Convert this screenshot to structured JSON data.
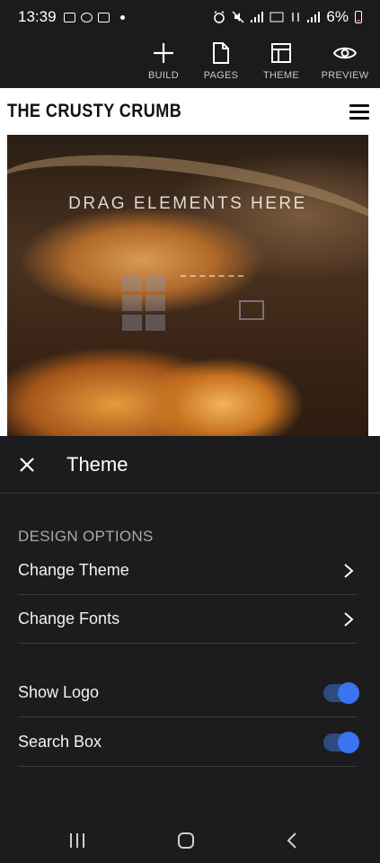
{
  "status_bar": {
    "time": "13:39",
    "battery": "6%"
  },
  "toolbar": {
    "items": [
      {
        "label": "BUILD",
        "icon": "plus-icon"
      },
      {
        "label": "PAGES",
        "icon": "page-icon"
      },
      {
        "label": "THEME",
        "icon": "layout-icon"
      },
      {
        "label": "PREVIEW",
        "icon": "eye-icon"
      }
    ]
  },
  "site": {
    "title": "THE CRUSTY CRUMB",
    "hero_text": "DRAG ELEMENTS HERE"
  },
  "panel": {
    "title": "Theme",
    "section_label": "DESIGN OPTIONS",
    "rows": [
      {
        "label": "Change Theme",
        "type": "link"
      },
      {
        "label": "Change Fonts",
        "type": "link"
      },
      {
        "label": "Show Logo",
        "type": "toggle",
        "on": true
      },
      {
        "label": "Search Box",
        "type": "toggle",
        "on": true
      }
    ]
  },
  "colors": {
    "accent": "#3b74f0",
    "panel_bg": "#1c1c1e",
    "divider": "#3a3a3c"
  }
}
